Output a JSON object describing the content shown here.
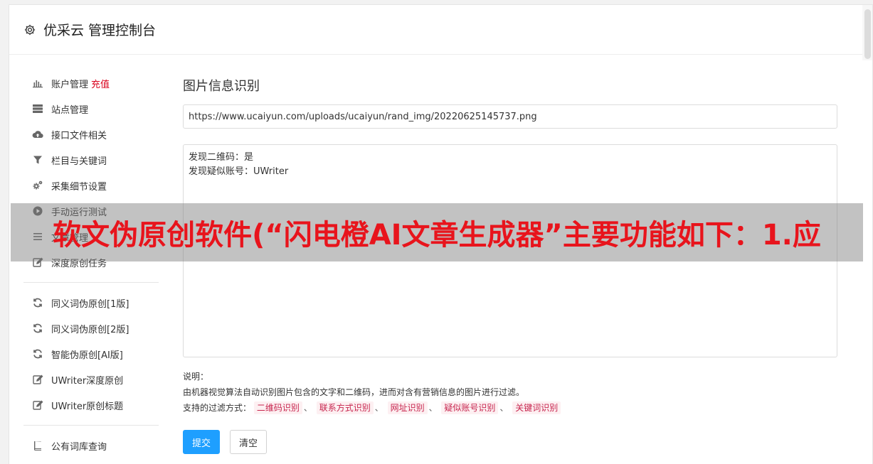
{
  "header": {
    "title": "优采云 管理控制台",
    "icon": "gear-icon"
  },
  "sidebar": {
    "recharge": "充值",
    "groups": [
      [
        {
          "label": "账户管理",
          "icon": "bar-chart-icon"
        },
        {
          "label": "站点管理",
          "icon": "server-icon"
        },
        {
          "label": "接口文件相关",
          "icon": "cloud-upload-icon"
        },
        {
          "label": "栏目与关键词",
          "icon": "filter-icon"
        },
        {
          "label": "采集细节设置",
          "icon": "cogs-icon"
        },
        {
          "label": "手动运行测试",
          "icon": "play-circle-icon"
        },
        {
          "label": "文章管理",
          "icon": "list-icon"
        },
        {
          "label": "深度原创任务",
          "icon": "edit-icon"
        }
      ],
      [
        {
          "label": "同义词伪原创[1版]",
          "icon": "refresh-icon"
        },
        {
          "label": "同义词伪原创[2版]",
          "icon": "refresh-icon"
        },
        {
          "label": "智能伪原创[AI版]",
          "icon": "refresh-icon"
        },
        {
          "label": "UWriter深度原创",
          "icon": "edit-icon"
        },
        {
          "label": "UWriter原创标题",
          "icon": "edit-icon"
        }
      ],
      [
        {
          "label": "公有词库查询",
          "icon": "book-icon"
        }
      ]
    ]
  },
  "main": {
    "title": "图片信息识别",
    "url_value": "https://www.ucaiyun.com/uploads/ucaiyun/rand_img/20220625145737.png",
    "result_text": "发现二维码：是\n发现疑似账号：UWriter",
    "notes_label": "说明：",
    "notes_desc": "由机器视觉算法自动识别图片包含的文字和二维码，进而对含有营销信息的图片进行过滤。",
    "filter_label": "支持的过滤方式：",
    "filter_separator": "、",
    "filter_tags": [
      "二维码识别",
      "联系方式识别",
      "网址识别",
      "疑似账号识别",
      "关键词识别"
    ],
    "submit_label": "提交",
    "clear_label": "清空"
  },
  "overlay": {
    "text": "软文伪原创软件(“闪电橙AI文章生成器”主要功能如下：1.应"
  },
  "colors": {
    "primary": "#1e9fff",
    "recharge": "#d9001b",
    "tag_text": "#c7254e",
    "tag_bg": "#fdf0f2",
    "overlay_text": "#e8141c"
  }
}
